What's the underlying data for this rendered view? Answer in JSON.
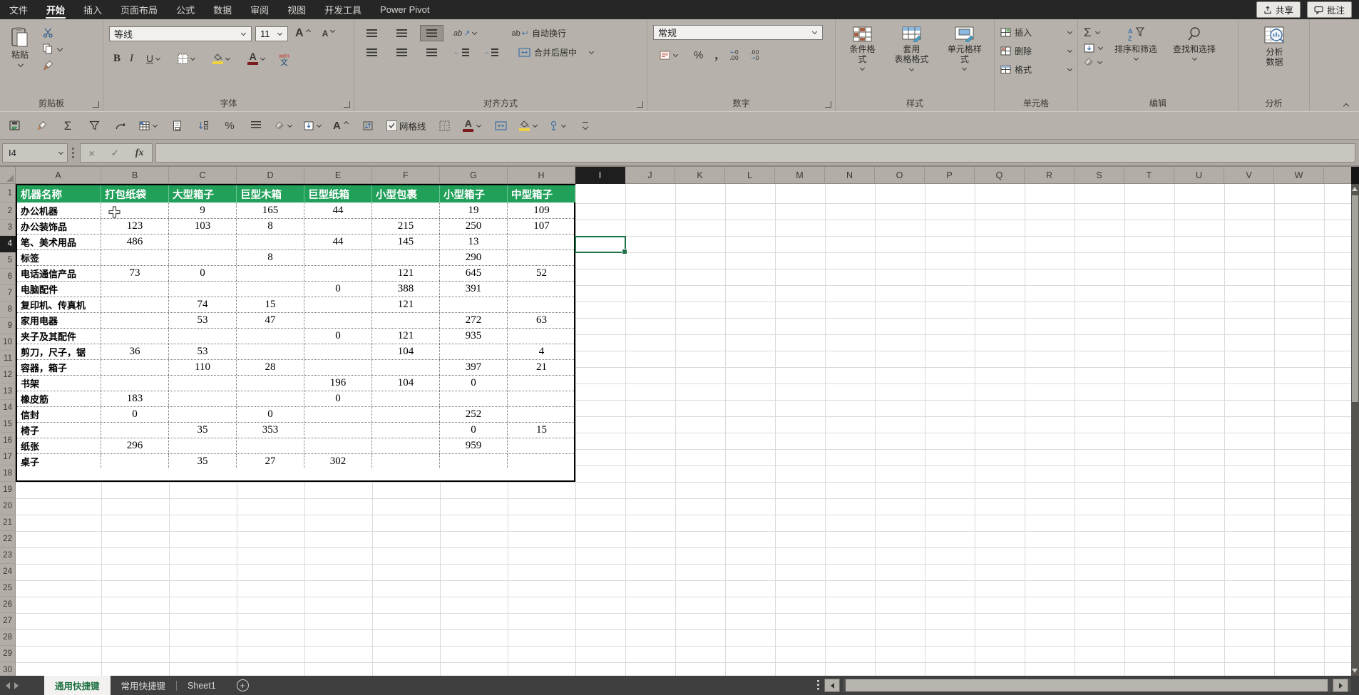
{
  "menubar": {
    "items": [
      {
        "label": "文件"
      },
      {
        "label": "开始"
      },
      {
        "label": "插入"
      },
      {
        "label": "页面布局"
      },
      {
        "label": "公式"
      },
      {
        "label": "数据"
      },
      {
        "label": "审阅"
      },
      {
        "label": "视图"
      },
      {
        "label": "开发工具"
      },
      {
        "label": "Power Pivot"
      }
    ],
    "active": "开始",
    "share_button": "共享",
    "comment_button": "批注"
  },
  "ribbon": {
    "clipboard": {
      "paste": "粘贴",
      "label": "剪贴板"
    },
    "font": {
      "font_name": "等线",
      "font_size": "11",
      "pinyin": "文",
      "label": "字体"
    },
    "alignment": {
      "wrap": "自动换行",
      "merge": "合并后居中",
      "label": "对齐方式"
    },
    "number": {
      "format": "常规",
      "label": "数字"
    },
    "styles": {
      "conditional": "条件格式",
      "table_format_1": "套用",
      "table_format_2": "表格格式",
      "cell_styles": "单元格样式",
      "label": "样式"
    },
    "cells": {
      "insert": "插入",
      "delete": "删除",
      "format": "格式",
      "label": "单元格"
    },
    "editing": {
      "sort_filter": "排序和筛选",
      "find_select": "查找和选择",
      "label": "编辑"
    },
    "analysis": {
      "button_1": "分析",
      "button_2": "数据",
      "label": "分析"
    }
  },
  "quick_toolbar": {
    "icons": [
      {
        "name": "save-icon"
      },
      {
        "name": "format-painter-icon"
      },
      {
        "name": "sum-icon"
      },
      {
        "name": "filter-icon"
      },
      {
        "name": "redo-icon"
      },
      {
        "name": "table-icon",
        "dropdown": true
      },
      {
        "name": "print-preview-icon"
      },
      {
        "name": "sort-icon"
      },
      {
        "name": "percent-icon"
      },
      {
        "name": "line-spacing-icon"
      },
      {
        "name": "eraser-icon",
        "dropdown": true
      },
      {
        "name": "fill-down-icon",
        "dropdown": true
      },
      {
        "name": "font-size-icon"
      },
      {
        "name": "row-height-icon"
      },
      {
        "name": "gridlines-checkbox",
        "label": "网格线",
        "checked": true
      },
      {
        "name": "border-icon"
      },
      {
        "name": "font-color-icon",
        "dropdown": true
      },
      {
        "name": "merge-cells-icon"
      },
      {
        "name": "fill-color-icon",
        "dropdown": true
      },
      {
        "name": "hand-icon",
        "dropdown": true
      },
      {
        "name": "more-commands-icon"
      }
    ]
  },
  "formula_bar": {
    "name_box": "I4",
    "fx_label": "fx",
    "formula_value": ""
  },
  "sheet": {
    "columns": [
      "A",
      "B",
      "C",
      "D",
      "E",
      "F",
      "G",
      "H",
      "I",
      "J",
      "K",
      "L",
      "M",
      "N",
      "O",
      "P",
      "Q",
      "R",
      "S",
      "T",
      "U",
      "V",
      "W"
    ],
    "visible_row_count": 30,
    "selected_cell": "I4",
    "selected_column": "I",
    "selected_row": 4,
    "colors": {
      "header_green": "#21a05a",
      "selection_green": "#1f7245",
      "header_dark": "#1e1e1e"
    },
    "table": {
      "headers": [
        "机器名称",
        "打包纸袋",
        "大型箱子",
        "巨型木箱",
        "巨型纸箱",
        "小型包裹",
        "小型箱子",
        "中型箱子"
      ],
      "rows": [
        {
          "name": "办公机器",
          "values": [
            "",
            "9",
            "165",
            "44",
            "",
            "19",
            "109"
          ]
        },
        {
          "name": "办公装饰品",
          "values": [
            "123",
            "103",
            "8",
            "",
            "215",
            "250",
            "107"
          ]
        },
        {
          "name": "笔、美术用品",
          "values": [
            "486",
            "",
            "",
            "44",
            "145",
            "13",
            ""
          ]
        },
        {
          "name": "标签",
          "values": [
            "",
            "",
            "8",
            "",
            "",
            "290",
            ""
          ]
        },
        {
          "name": "电话通信产品",
          "values": [
            "73",
            "0",
            "",
            "",
            "121",
            "645",
            "52"
          ]
        },
        {
          "name": "电脑配件",
          "values": [
            "",
            "",
            "",
            "0",
            "388",
            "391",
            ""
          ]
        },
        {
          "name": "复印机、传真机",
          "values": [
            "",
            "74",
            "15",
            "",
            "121",
            "",
            ""
          ]
        },
        {
          "name": "家用电器",
          "values": [
            "",
            "53",
            "47",
            "",
            "",
            "272",
            "63"
          ]
        },
        {
          "name": "夹子及其配件",
          "values": [
            "",
            "",
            "",
            "0",
            "121",
            "935",
            ""
          ]
        },
        {
          "name": "剪刀，尺子，锯",
          "values": [
            "36",
            "53",
            "",
            "",
            "104",
            "",
            "4"
          ]
        },
        {
          "name": "容器，箱子",
          "values": [
            "",
            "110",
            "28",
            "",
            "",
            "397",
            "21"
          ]
        },
        {
          "name": "书架",
          "values": [
            "",
            "",
            "",
            "196",
            "104",
            "0",
            ""
          ]
        },
        {
          "name": "橡皮筋",
          "values": [
            "183",
            "",
            "",
            "0",
            "",
            "",
            ""
          ]
        },
        {
          "name": "信封",
          "values": [
            "0",
            "",
            "0",
            "",
            "",
            "252",
            ""
          ]
        },
        {
          "name": "椅子",
          "values": [
            "",
            "35",
            "353",
            "",
            "",
            "0",
            "15"
          ]
        },
        {
          "name": "纸张",
          "values": [
            "296",
            "",
            "",
            "",
            "",
            "959",
            ""
          ]
        },
        {
          "name": "桌子",
          "values": [
            "",
            "35",
            "27",
            "302",
            "",
            "",
            ""
          ]
        }
      ]
    }
  },
  "tabbar": {
    "tabs": [
      {
        "label": "通用快捷键",
        "active": true
      },
      {
        "label": "常用快捷键",
        "active": false
      },
      {
        "label": "Sheet1",
        "active": false
      }
    ]
  }
}
